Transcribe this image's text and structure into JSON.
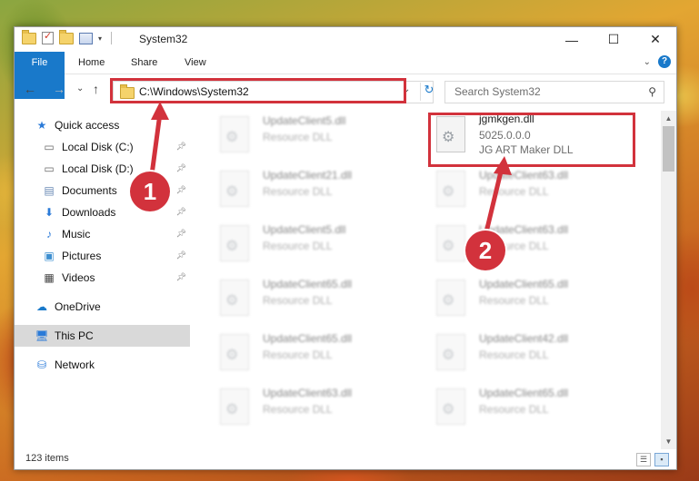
{
  "window": {
    "title": "System32",
    "controls": {
      "minimize": "—",
      "maximize": "☐",
      "close": "✕"
    }
  },
  "ribbon": {
    "tabs": [
      "File",
      "Home",
      "Share",
      "View"
    ]
  },
  "navbar": {
    "back": "←",
    "forward": "→",
    "recent": "⌄",
    "up": "↑",
    "address": "C:\\Windows\\System32",
    "search_placeholder": "Search System32"
  },
  "sidebar": {
    "items": [
      {
        "label": "Quick access",
        "icon": "star-icon"
      },
      {
        "label": "Local Disk (C:)",
        "icon": "drive-icon",
        "pinned": true
      },
      {
        "label": "Local Disk (D:)",
        "icon": "drive-icon",
        "pinned": true
      },
      {
        "label": "Documents",
        "icon": "documents-icon",
        "pinned": true
      },
      {
        "label": "Downloads",
        "icon": "downloads-icon",
        "pinned": true
      },
      {
        "label": "Music",
        "icon": "music-icon",
        "pinned": true
      },
      {
        "label": "Pictures",
        "icon": "pictures-icon",
        "pinned": true
      },
      {
        "label": "Videos",
        "icon": "videos-icon",
        "pinned": true
      },
      {
        "label": "OneDrive",
        "icon": "onedrive-icon"
      },
      {
        "label": "This PC",
        "icon": "pc-icon",
        "selected": true
      },
      {
        "label": "Network",
        "icon": "network-icon"
      }
    ]
  },
  "files": {
    "left": [
      {
        "name": "UpdateClient5.dll",
        "desc": "Resource DLL"
      },
      {
        "name": "UpdateClient21.dll",
        "desc": "Resource DLL"
      },
      {
        "name": "UpdateClient5.dll",
        "desc": "Resource DLL"
      },
      {
        "name": "UpdateClient65.dll",
        "desc": "Resource DLL"
      },
      {
        "name": "UpdateClient65.dll",
        "desc": "Resource DLL"
      },
      {
        "name": "UpdateClient63.dll",
        "desc": "Resource DLL"
      }
    ],
    "right": [
      {
        "name": "jgmkgen.dll",
        "version": "5025.0.0.0",
        "desc": "JG ART Maker DLL"
      },
      {
        "name": "UpdateClient63.dll",
        "desc": "Resource DLL"
      },
      {
        "name": "UpdateClient63.dll",
        "desc": "Resource DLL"
      },
      {
        "name": "UpdateClient65.dll",
        "desc": "Resource DLL"
      },
      {
        "name": "UpdateClient42.dll",
        "desc": "Resource DLL"
      },
      {
        "name": "UpdateClient65.dll",
        "desc": "Resource DLL"
      }
    ]
  },
  "status": {
    "count": "123 items"
  },
  "annotations": {
    "marker1": "1",
    "marker2": "2",
    "color": "#d2323c"
  }
}
